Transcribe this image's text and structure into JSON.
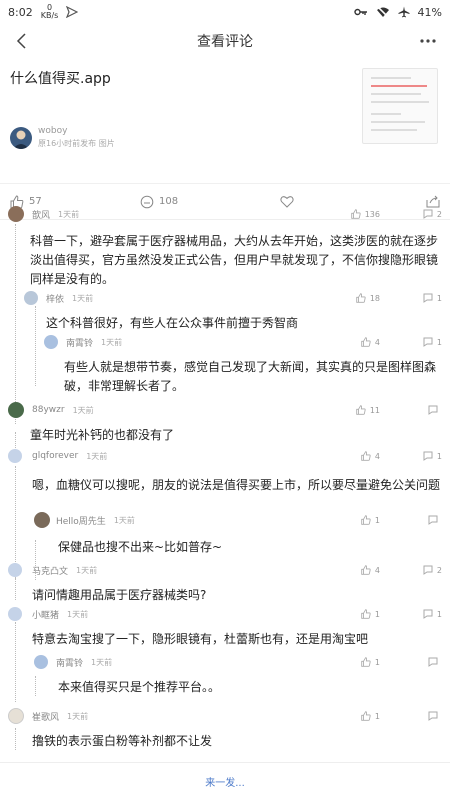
{
  "status": {
    "time": "8:02",
    "speed_value": "0",
    "speed_unit": "KB/s",
    "battery": "41%"
  },
  "header": {
    "title": "查看评论"
  },
  "post": {
    "title": "什么值得买.app",
    "author": "woboy",
    "meta": "原16小时前发布  图片"
  },
  "actions": {
    "likes": "57",
    "comments": "108"
  },
  "comments": [
    {
      "user": "歆风",
      "time": "1天前",
      "likes": "136",
      "replies": "2",
      "text": "科普一下，避孕套属于医疗器械用品，大约从去年开始，这类涉医的就在逐步淡出值得买，官方虽然没发正式公告，但用户早就发现了，不信你搜隐形眼镜同样是没有的。"
    },
    {
      "user": "梓依",
      "time": "1天前",
      "likes": "18",
      "replies": "1",
      "text": "这个科普很好，有些人在公众事件前擅于秀智商"
    },
    {
      "user": "南霄铃",
      "time": "1天前",
      "likes": "4",
      "replies": "1",
      "text": "有些人就是想带节奏，感觉自己发现了大新闻，其实真的只是图样图森破，非常理解长者了。"
    },
    {
      "user": "88ywzr",
      "time": "1天前",
      "likes": "11",
      "replies": "",
      "text": "童年时光补钙的也都没有了"
    },
    {
      "user": "glqforever",
      "time": "1天前",
      "likes": "4",
      "replies": "1",
      "text": "嗯，血糖仪可以搜呢，朋友的说法是值得买要上市，所以要尽量避免公关问题"
    },
    {
      "user": "Hello周先生",
      "time": "1天前",
      "likes": "1",
      "replies": "",
      "text": "保健品也搜不出来~比如普存~"
    },
    {
      "user": "马克凸文",
      "time": "1天前",
      "likes": "4",
      "replies": "2",
      "text": "请问情趣用品属于医疗器械类吗?"
    },
    {
      "user": "小眶猪",
      "time": "1天前",
      "likes": "1",
      "replies": "1",
      "text": "特意去淘宝搜了一下，隐形眼镜有，杜蕾斯也有，还是用淘宝吧"
    },
    {
      "user": "南霄铃",
      "time": "1天前",
      "likes": "1",
      "replies": "",
      "text": "本来值得买只是个推荐平台。。"
    },
    {
      "user": "崔歌风",
      "time": "1天前",
      "likes": "1",
      "replies": "",
      "text": "撸铁的表示蛋白粉等补剂都不让发"
    }
  ],
  "footer": {
    "placeholder": "来一发..."
  },
  "colors": {
    "accent": "#4a78c8",
    "muted": "#999999"
  },
  "icons": [
    "back-icon",
    "more-icon",
    "thumb-up-icon",
    "comment-icon",
    "heart-icon",
    "share-icon",
    "reply-icon"
  ]
}
